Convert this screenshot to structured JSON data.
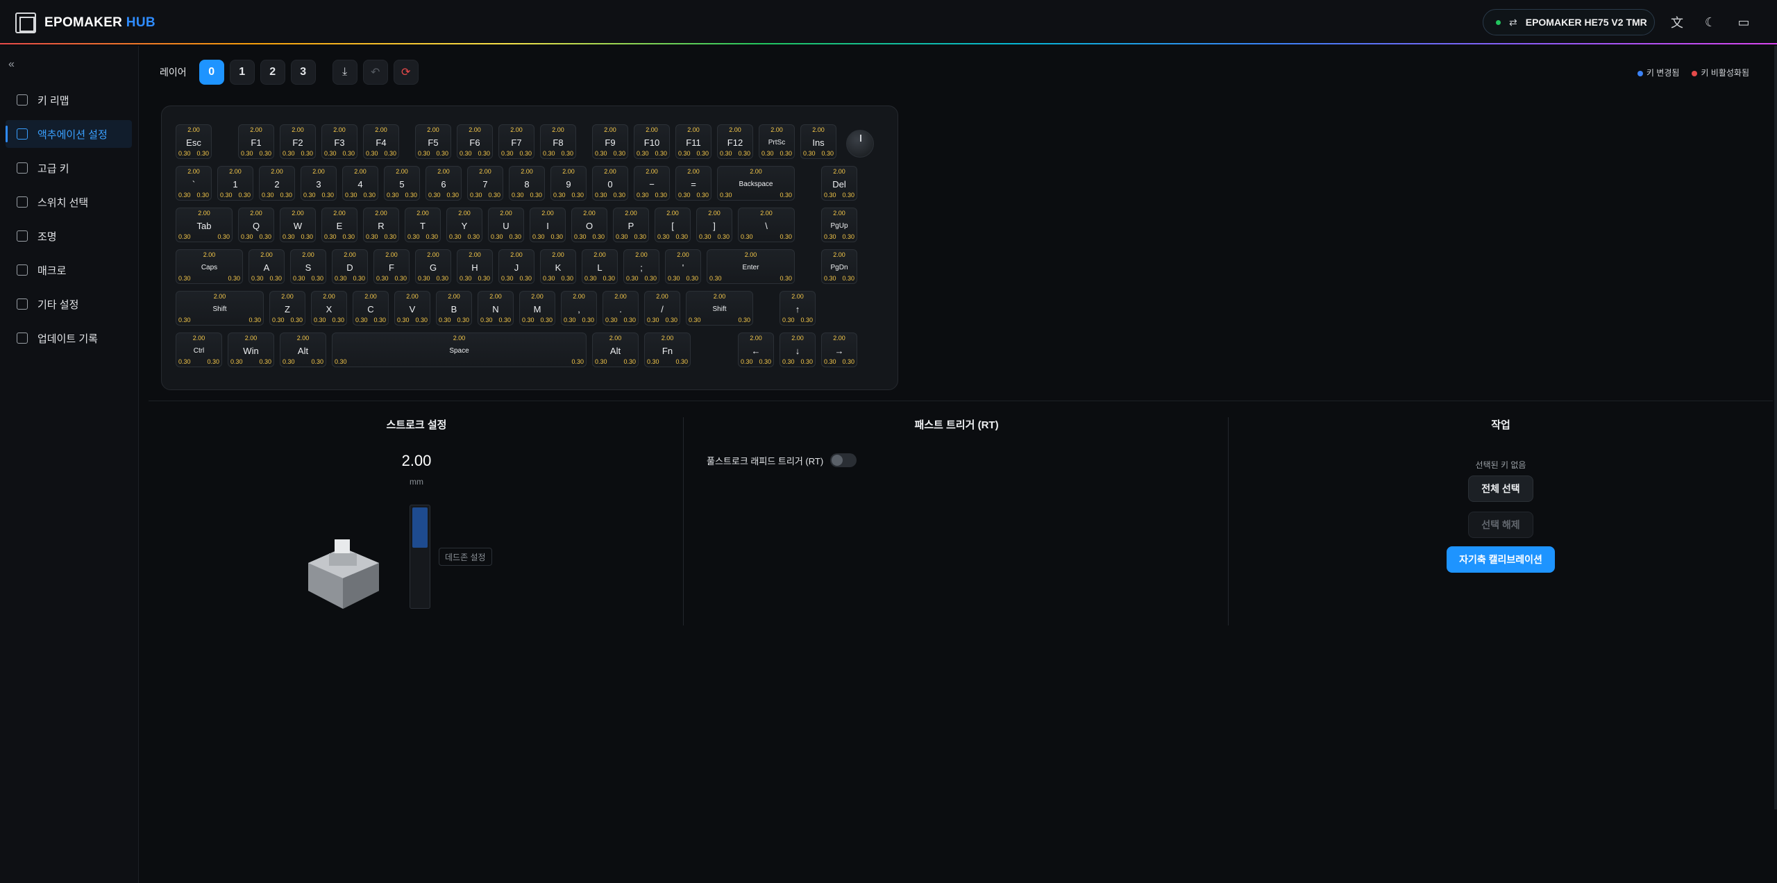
{
  "header": {
    "logo_text": "EPOMAKER",
    "logo_hub": "HUB",
    "device_name": "EPOMAKER HE75 V2 TMR",
    "icons": [
      "translate-icon",
      "moon-icon",
      "chat-icon"
    ]
  },
  "sidebar": {
    "items": [
      {
        "label": "키 리맵",
        "icon": "keyboard-icon"
      },
      {
        "label": "액추에이션 설정",
        "icon": "actuation-icon",
        "active": true
      },
      {
        "label": "고급 키",
        "icon": "advanced-key-icon"
      },
      {
        "label": "스위치 선택",
        "icon": "switch-icon"
      },
      {
        "label": "조명",
        "icon": "light-icon"
      },
      {
        "label": "매크로",
        "icon": "macro-icon"
      },
      {
        "label": "기타 설정",
        "icon": "grid-icon"
      },
      {
        "label": "업데이트 기록",
        "icon": "document-icon"
      }
    ]
  },
  "toolbar": {
    "layer_label": "레이어",
    "layers": [
      "0",
      "1",
      "2",
      "3"
    ]
  },
  "legend": {
    "changed": "키 변경됨",
    "disabled": "키 비활성화됨",
    "changed_color": "#3b82f6",
    "disabled_color": "#e64a4a"
  },
  "keyboard": {
    "top_value": "2.00",
    "bottom_left": "0.30",
    "bottom_right": "0.30",
    "rows": [
      [
        "Esc",
        "F1",
        "F2",
        "F3",
        "F4",
        "F5",
        "F6",
        "F7",
        "F8",
        "F9",
        "F10",
        "F11",
        "F12",
        "PrtSc",
        "Ins"
      ],
      [
        "`",
        "1",
        "2",
        "3",
        "4",
        "5",
        "6",
        "7",
        "8",
        "9",
        "0",
        "−",
        "=",
        "Backspace",
        "Del"
      ],
      [
        "Tab",
        "Q",
        "W",
        "E",
        "R",
        "T",
        "Y",
        "U",
        "I",
        "O",
        "P",
        "[",
        "]",
        "\\",
        "PgUp"
      ],
      [
        "Caps",
        "A",
        "S",
        "D",
        "F",
        "G",
        "H",
        "J",
        "K",
        "L",
        ";",
        "'",
        "Enter",
        "PgDn"
      ],
      [
        "Shift",
        "Z",
        "X",
        "C",
        "V",
        "B",
        "N",
        "M",
        ",",
        ".",
        "/",
        "Shift",
        "↑"
      ],
      [
        "Ctrl",
        "Win",
        "Alt",
        "Space",
        "Alt",
        "Fn",
        "←",
        "↓",
        "→"
      ]
    ]
  },
  "stroke": {
    "title": "스트로크 설정",
    "value": "2.00",
    "unit": "mm",
    "level_fraction": 0.41,
    "deadzone_label": "데드존 설정"
  },
  "rt": {
    "title": "패스트 트리거 (RT)",
    "full_stroke_label": "풀스트로크 래피드 트리거 (RT)"
  },
  "actions": {
    "title": "작업",
    "no_selection": "선택된 키 없음",
    "select_all": "전체 선택",
    "deselect": "선택 해제",
    "calibrate": "자기축 캘리브레이션"
  }
}
